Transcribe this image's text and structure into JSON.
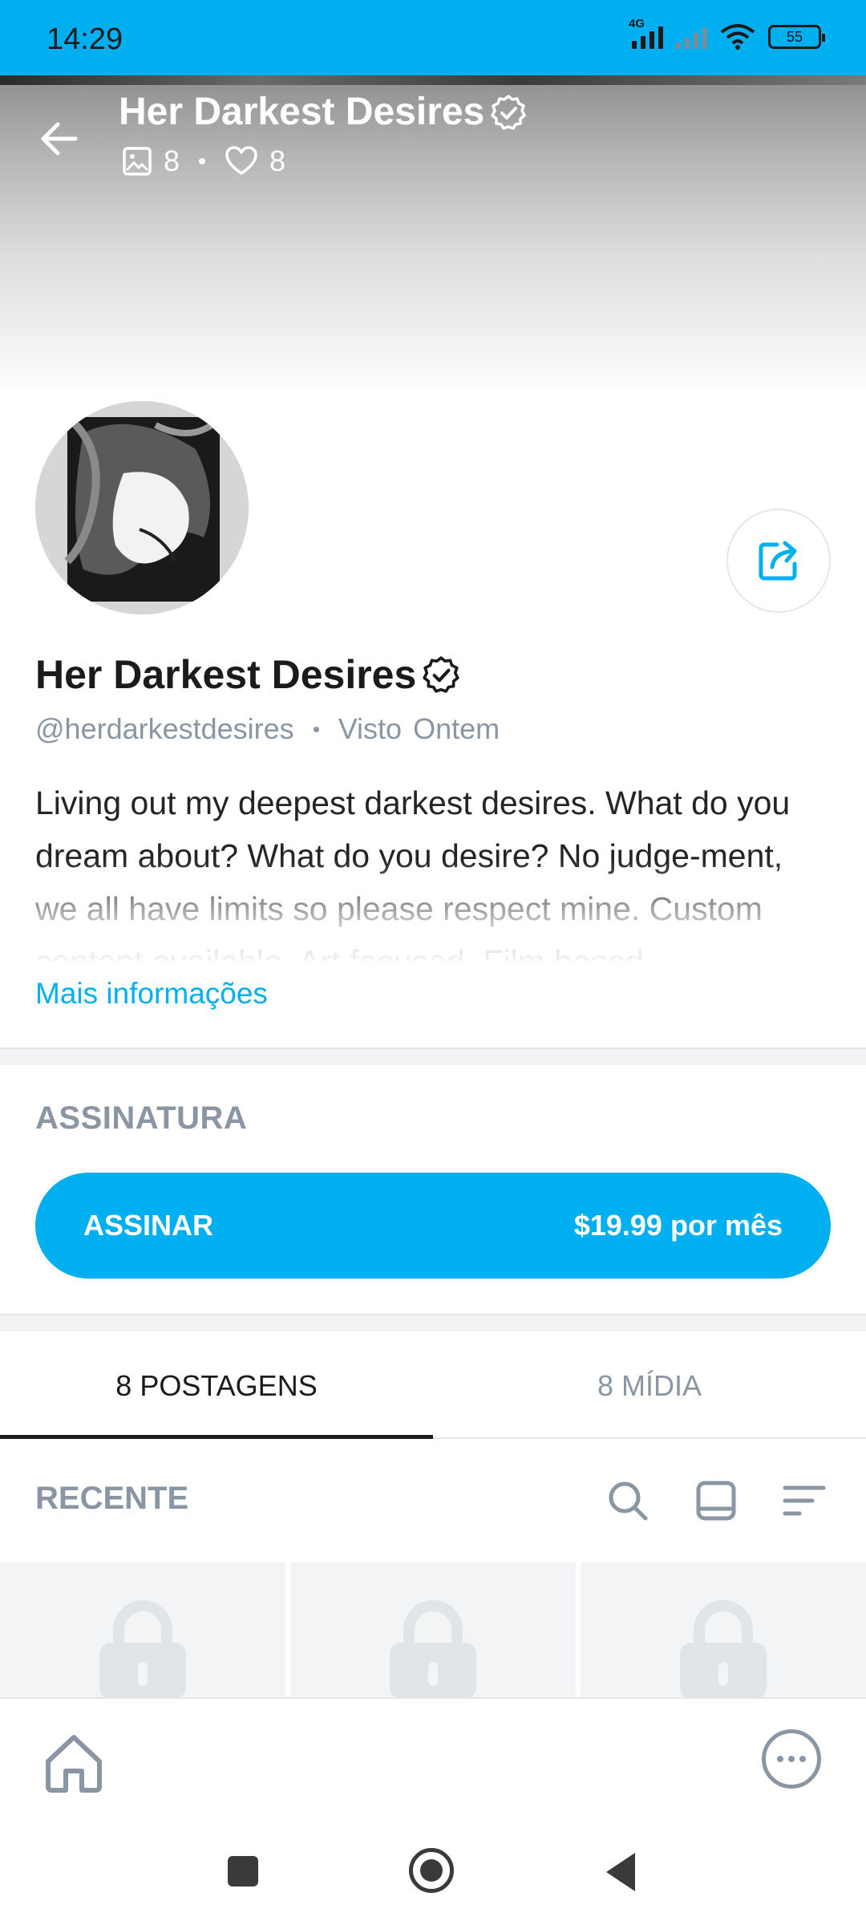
{
  "status_bar": {
    "time": "14:29",
    "network_label": "4G",
    "battery": "55"
  },
  "header": {
    "title": "Her Darkest Desires",
    "media_count": "8",
    "likes_count": "8"
  },
  "profile": {
    "name": "Her Darkest Desires",
    "handle": "@herdarkestdesires",
    "last_seen_label": "Visto",
    "last_seen_value": "Ontem",
    "bio": "Living out my deepest darkest desires. What do you dream about? What do you desire? No judge-ment, we all have limits so please respect mine. Custom content available. Art focused. Film based",
    "more_info": "Mais informações"
  },
  "subscription": {
    "label": "ASSINATURA",
    "button_label": "ASSINAR",
    "price": "$19.99 por mês"
  },
  "tabs": [
    {
      "label": "8 POSTAGENS"
    },
    {
      "label": "8 MÍDIA"
    }
  ],
  "feed": {
    "sort_label": "RECENTE"
  },
  "colors": {
    "accent": "#00aff0",
    "muted": "#8a96a3",
    "text": "#1b1b1b"
  },
  "icons": {
    "back": "arrow-left-icon",
    "verified": "verified-badge-icon",
    "media": "image-icon",
    "likes": "heart-icon",
    "share": "share-icon",
    "search": "search-icon",
    "layout": "layout-icon",
    "sort": "sort-icon",
    "lock": "lock-icon",
    "home": "home-icon",
    "more": "more-icon"
  }
}
